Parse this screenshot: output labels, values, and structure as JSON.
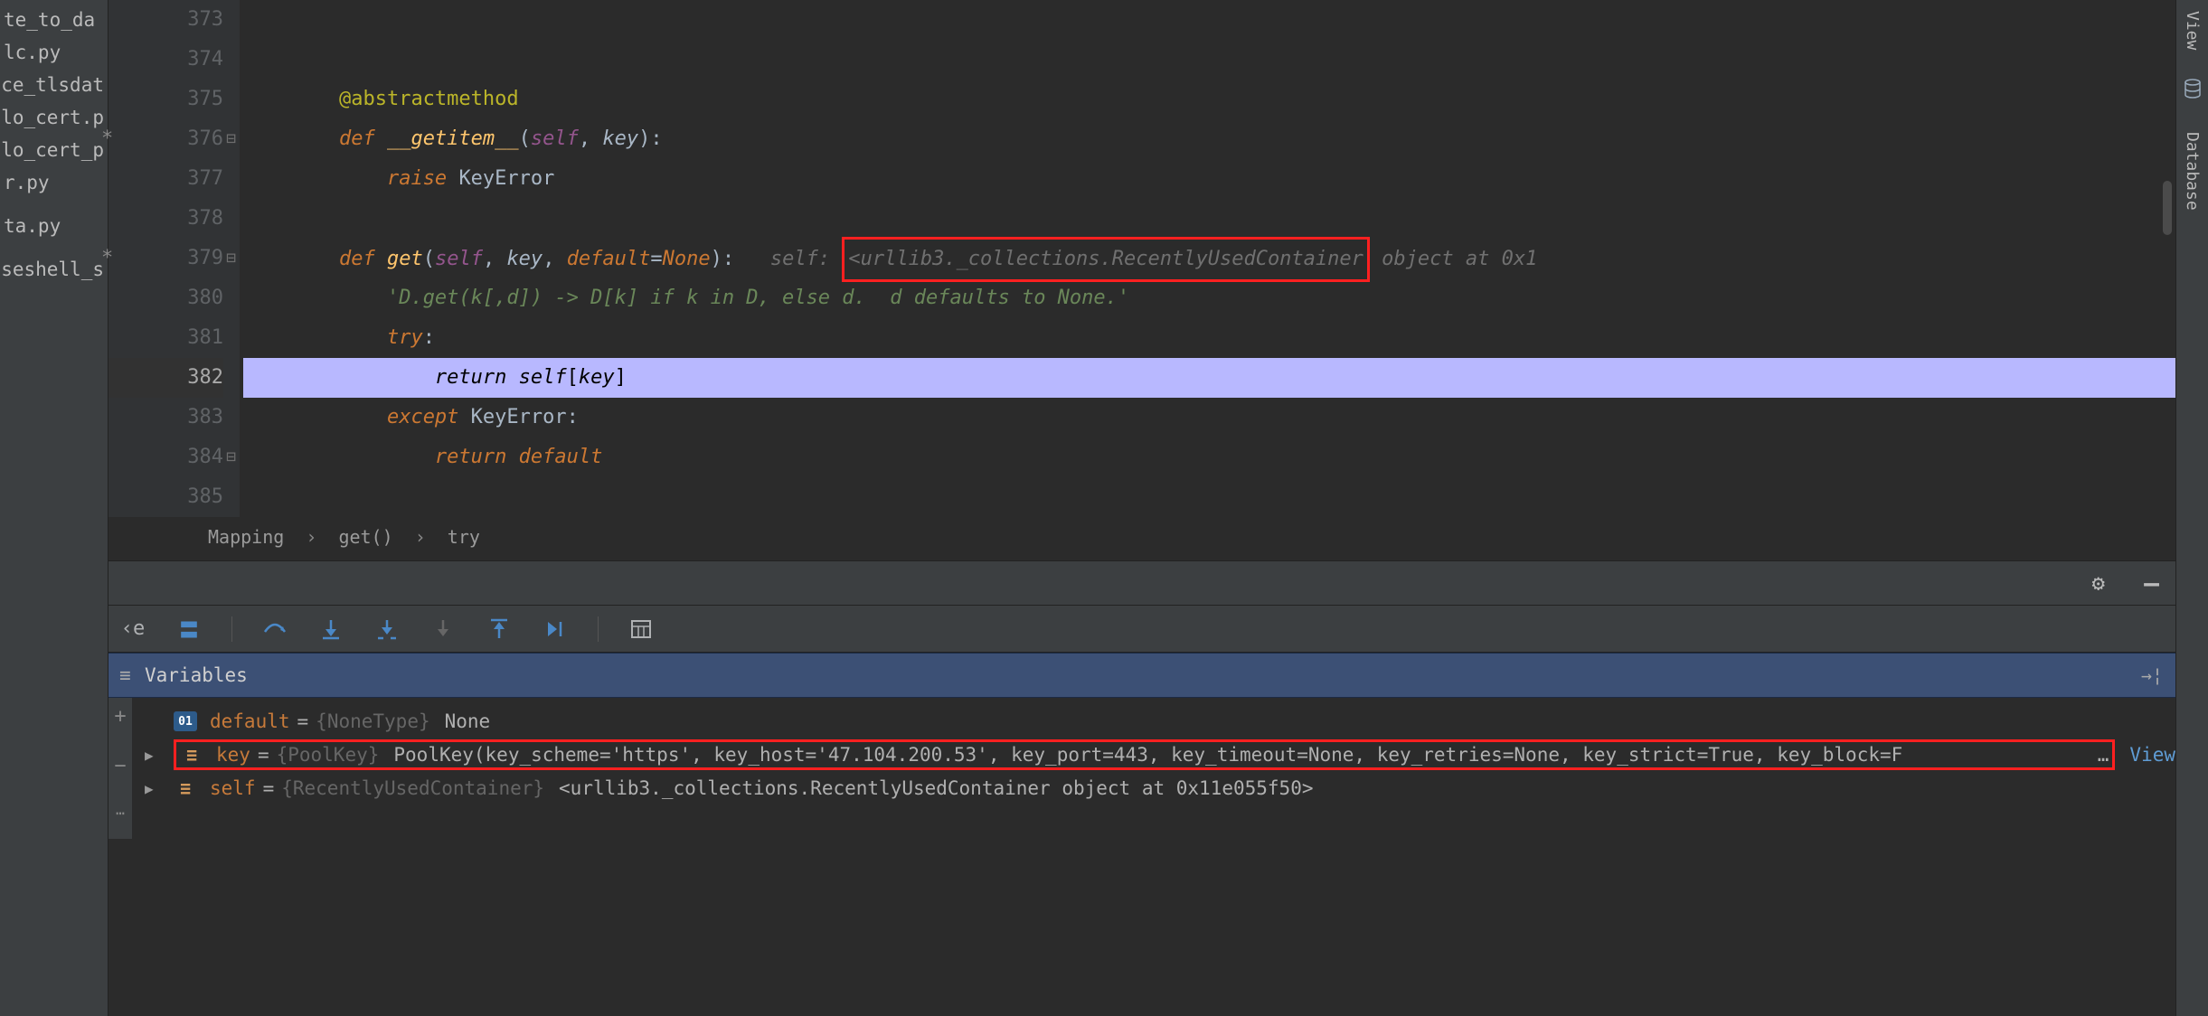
{
  "sidebar_files": [
    "te_to_da",
    "lc.py",
    "ce_tlsdat",
    "lo_cert.p",
    "lo_cert_p",
    "r.py",
    "",
    "ta.py",
    "",
    "seshell_s"
  ],
  "gutter": {
    "start": 373,
    "end": 385,
    "marks": {
      "376": "*",
      "379": "*"
    },
    "current": 382
  },
  "code": {
    "l373": "",
    "l374": "",
    "l375_dec": "@abstractmethod",
    "l376_def": "def ",
    "l376_fn": "__getitem__",
    "l376_self": "self",
    "l376_key": "key",
    "l377_raise": "raise ",
    "l377_exc": "KeyError",
    "l379_def": "def ",
    "l379_fn": "get",
    "l379_self": "self",
    "l379_key": "key",
    "l379_default": "default",
    "l379_none": "None",
    "l379_dbg_self": "self: ",
    "l379_dbg_boxed": "<urllib3._collections.RecentlyUsedContainer",
    "l379_dbg_tail": " object at 0x1",
    "l380_str": "'D.get(k[,d]) -> D[k] if k in D, else d.  d defaults to None.'",
    "l381_try": "try",
    "l382_return": "return ",
    "l382_self": "self",
    "l382_key": "key",
    "l383_except": "except ",
    "l383_exc": "KeyError",
    "l384_return": "return ",
    "l384_default": "default"
  },
  "breadcrumb": {
    "a": "Mapping",
    "b": "get()",
    "c": "try"
  },
  "variables_title": "Variables",
  "vars": {
    "default": {
      "name": "default",
      "type": "{NoneType}",
      "val": "None"
    },
    "key": {
      "name": "key",
      "type": "{PoolKey}",
      "val": "PoolKey(key_scheme='https', key_host='47.104.200.53', key_port=443, key_timeout=None, key_retries=None, key_strict=True, key_block=F",
      "ellipsis": "…",
      "view": "View"
    },
    "self": {
      "name": "self",
      "type": "{RecentlyUsedContainer}",
      "val": "<urllib3._collections.RecentlyUsedContainer object at 0x11e055f50>"
    }
  },
  "right_rail": {
    "tab1": "View",
    "tab2": "Database"
  }
}
